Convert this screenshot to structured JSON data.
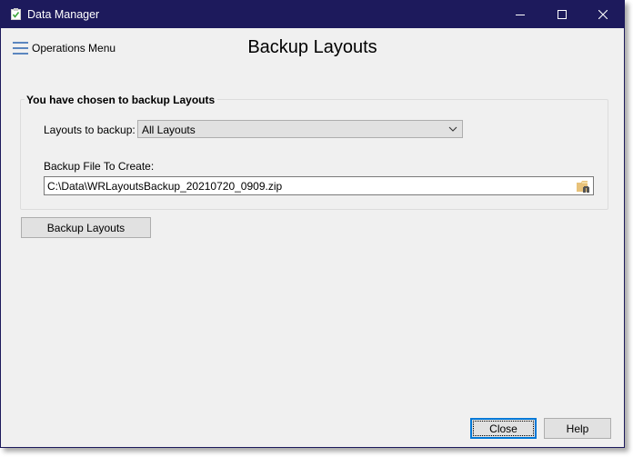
{
  "window": {
    "title": "Data Manager",
    "controls": {
      "minimize": "minimize",
      "maximize": "maximize",
      "close": "close"
    }
  },
  "header": {
    "menu_label": "Operations Menu",
    "page_title": "Backup Layouts"
  },
  "group": {
    "legend": "You have chosen to backup Layouts",
    "layouts_label": "Layouts to backup:",
    "layouts_selected": "All Layouts",
    "file_label": "Backup File To Create:",
    "file_value": "C:\\Data\\WRLayoutsBackup_20210720_0909.zip"
  },
  "actions": {
    "backup_label": "Backup Layouts",
    "close_label": "Close",
    "help_label": "Help"
  },
  "colors": {
    "titlebar": "#1d1a5c",
    "accent": "#0078d7",
    "menu_icon": "#5b86bf"
  }
}
